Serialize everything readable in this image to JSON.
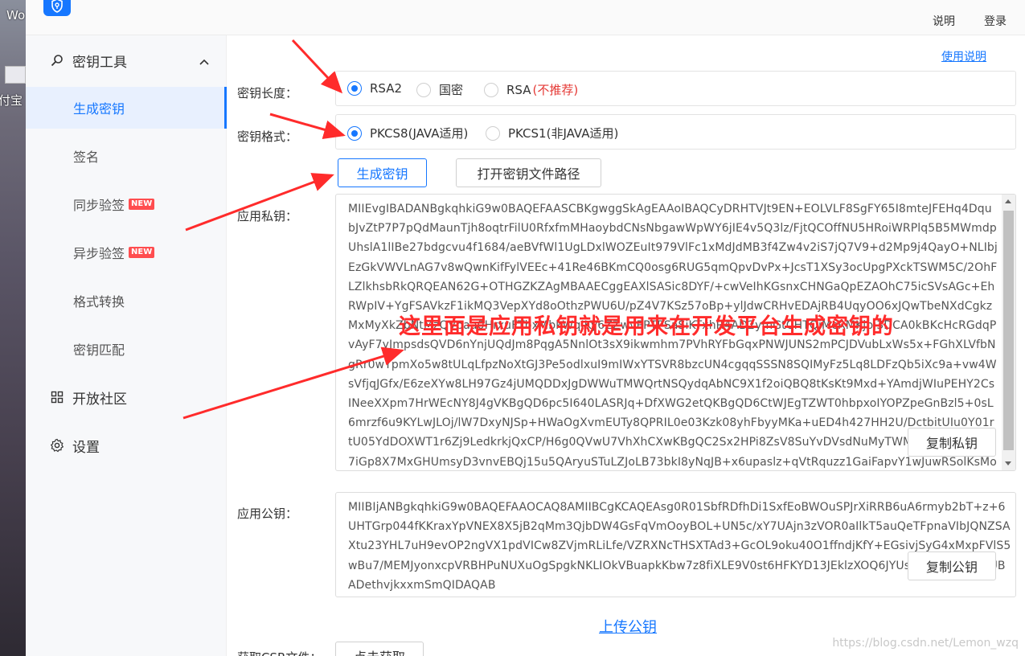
{
  "desktop": {
    "label_top": "Wo",
    "label_mid": "付宝"
  },
  "header": {
    "help_label": "说明",
    "login_label": "登录"
  },
  "sidebar": {
    "group_tools": "密钥工具",
    "items": [
      {
        "label": "生成密钥",
        "active": true
      },
      {
        "label": "签名"
      },
      {
        "label": "同步验签",
        "badge": "NEW"
      },
      {
        "label": "异步验签",
        "badge": "NEW"
      },
      {
        "label": "格式转换"
      },
      {
        "label": "密钥匹配"
      }
    ],
    "group_community": "开放社区",
    "group_settings": "设置"
  },
  "main": {
    "usage_link": "使用说明",
    "key_length": {
      "label": "密钥长度：",
      "options": [
        "RSA2",
        "国密",
        "RSA"
      ],
      "rsa_note": "(不推荐)",
      "selected": "RSA2"
    },
    "key_format": {
      "label": "密钥格式：",
      "options": [
        "PKCS8(JAVA适用)",
        "PKCS1(非JAVA适用)"
      ],
      "selected": "PKCS8(JAVA适用)"
    },
    "generate_button": "生成密钥",
    "open_path_button": "打开密钥文件路径",
    "private_key": {
      "label": "应用私钥：",
      "value": "MIIEvgIBADANBgkqhkiG9w0BAQEFAASCBKgwggSkAgEAAoIBAQCyDRHTVJt9EN+EOLVLF8SgFY65I8mteJFEHq4DqubJvZtP7P7pQdMaunTjh8oqtrFilU0RfxfmMHaoybdCNsNbgawWpWY6jIE4v5Q3lz/FjtQCOffNU5HRoiWRPlq5B5MWmdpUhslA1lIBe27bdgcvu4f1684/aeBVfWl1UgLDxlWOZEuIt979VlFc1xMdJdMB3f4Zw4v2iS7jQ7V9+d2Mp9j4QayO+NLIbjEzGkVWVLnAG7v8wQwnKifFylVEEc+41Re46BKmCQ0osg6RUG5qmQpvDvPx+JcsT1XSy3ocUpgPXckTSWM5C/2OhFLZlkhsbRkQRQEAN62G+OTHGZKZAgMBAAECggEAXlSASic8DYF/+cwVeIhKGsnxCHNGaQpEZAOhC75icSVsAGc+EhRWpIV+YgFSAVkzF1ikMQ3VepXYd8oOthzPWU6U/pZ4V7KSz57oBp+ylJdwCRHvEDAjRB4UqyOO6xJQwTbeNXdCgkzMxMyXkZbNtMzQVpaa0HrxuFTbxMbkWqJKy6ZZwvPPTPSaSiKTxhR4AD2ymGtCHTQiMcRMKjbj3DCA0kBKcHcRGdqPvAyF7yJmpsdsQVD6nYnjUQdJm8PqgA5NnlOt3sX9ikwmhm7PVhRYFbGqxPNWJUNS2mPCJDVubLxWs5x+FGhXLVfbNgRr0wYpmXo5w8tULqLfpzNoXtGJ3Pe5odlxuI9mIWxYTSVR8bzcUN4cgqqSSSN8SQIMyFz5Lq8LDFzQb5iXc9a+vw4WsVfjqJGfx/E6zeXYw8LH97Gz4jUMQDDxJgDWWuTMWQrtNSQydqAbNC9X1f2oiQBQ8tKsKt9Mxd+YAmdjWIuPEHY2CsINeeXXpm7HrWEcNY8J4gVKBgQD6pc5I640LASRJq+DfXWG2etQKBgQD6CtWJEgTZWT0hbpxoIYOPZpeGnBzl5+0sL6mrzf6u9KYLwJLOj/lW7DxyNJSp+HWaOgXvmEUTy8QPRIL0e03Kzk08yhFbyyMKa+uED4h427HH2U/DctbitUIu0Y01rtU05YdDOXWT1r6Zj9LedkrkjQxCP/H6g0QVwU7VhXhCXwKBgQC2Sx2HPi8ZsV8SuYvDVsdNuMyTWMJe1pciNcv2GO7iGp8X7MxGHUmsyD3vnvEBQj15u5QAryuSTuLZJoLB73bkI8yNqJB+x6upaslz+qVtRquzz1GaiFapvY1wJuwRSolKsMoPR/PV5/TVyENeuF76PpEbbmQAYIuaWRcLQ/t+BwKBgHw13ZXV6aq+9eshs3jXDS+zWxp3erCNOtBvHzr0NQ2drKTmOTGIDE7QjsTqMFqZs55l0gaMh2EtjENt3yksjZ1R27ndkQ1QqyAGXULoWdVxW1ef3CaSisT6yFFpAvn7bWP8XvhUL5d7+NtuB46Sch90dI"
    },
    "public_key": {
      "label": "应用公钥：",
      "value": "MIIBIjANBgkqhkiG9w0BAQEFAAOCAQ8AMIIBCgKCAQEAsg0R01SbfRDfhDi1SxfEoBWOuSPJrXiRRB6uA6rmyb2bT+z+6UHTGrp044fKKraxYpVNEX8X5jB2qMm3QjbDW4GsFqVmOoyBOL+UN5c/xY7UAjn3zVOR0aIlkT5auQeTFpnaVIbJQNZSAXtu23YHL7uH9evOP2ngVX1pdVICw8ZVjmRLiLfe/VZRXNcTHSXTAd3+GcOL9oku40O1ffndjKfY+EGsivjSyG4xMxpFVlS5wBu7/MEMJyonxcpVRBHPuNUXuOgSpgkNKLIOkVBuapkKbw7z8fiXLE9V0st6HFKYD13JEklzXOQ6JYUs0WfZIbG0ZEEUBADethvjkxxmSmQIDAQAB"
    },
    "copy_private_button": "复制私钥",
    "copy_public_button": "复制公钥",
    "upload_link": "上传公钥",
    "csr_label": "获取CSR文件：",
    "csr_button": "点击获取"
  },
  "annotation_text": "这里面是应用私钥就是用来在开发平台生成密钥的",
  "watermark": "https://blog.csdn.net/Lemon_wzq",
  "colors": {
    "accent": "#1677ff",
    "annotation": "#ff2b2b",
    "warning": "#e53935"
  }
}
